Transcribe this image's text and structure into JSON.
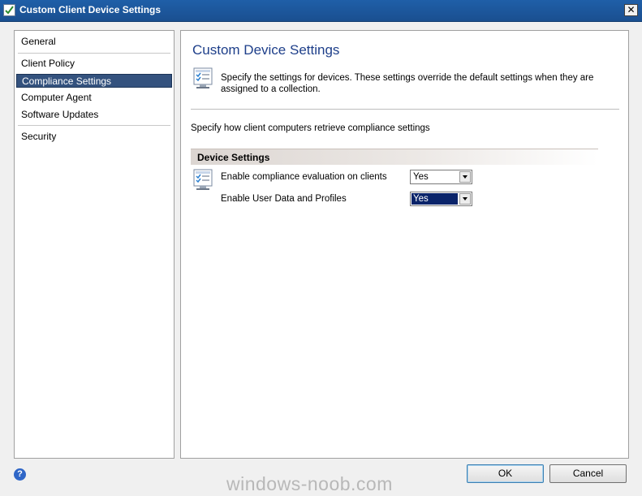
{
  "window": {
    "title": "Custom Client Device Settings",
    "close_glyph": "✕"
  },
  "nav": {
    "items": [
      {
        "label": "General"
      },
      {
        "label": "Client Policy"
      },
      {
        "label": "Compliance Settings"
      },
      {
        "label": "Computer Agent"
      },
      {
        "label": "Software Updates"
      },
      {
        "label": "Security"
      }
    ],
    "selected": "Compliance Settings"
  },
  "main": {
    "title": "Custom Device Settings",
    "description": "Specify the settings for devices. These settings override the default settings when they are assigned to a collection.",
    "subtext": "Specify how client computers retrieve compliance settings",
    "section_header": "Device Settings",
    "settings": [
      {
        "label": "Enable compliance evaluation on clients",
        "value": "Yes"
      },
      {
        "label": "Enable User Data and Profiles",
        "value": "Yes"
      }
    ]
  },
  "footer": {
    "help_glyph": "?",
    "ok_label": "OK",
    "cancel_label": "Cancel"
  },
  "watermark": "windows-noob.com",
  "colors": {
    "titlebar": "#1f5fa8",
    "selection": "#34527e",
    "title_text": "#1e3f8a",
    "focus": "#0a246a"
  },
  "icons": [
    "checklist-app-icon",
    "close-icon",
    "settings-checklist-icon",
    "dropdown-arrow-icon",
    "help-icon"
  ]
}
